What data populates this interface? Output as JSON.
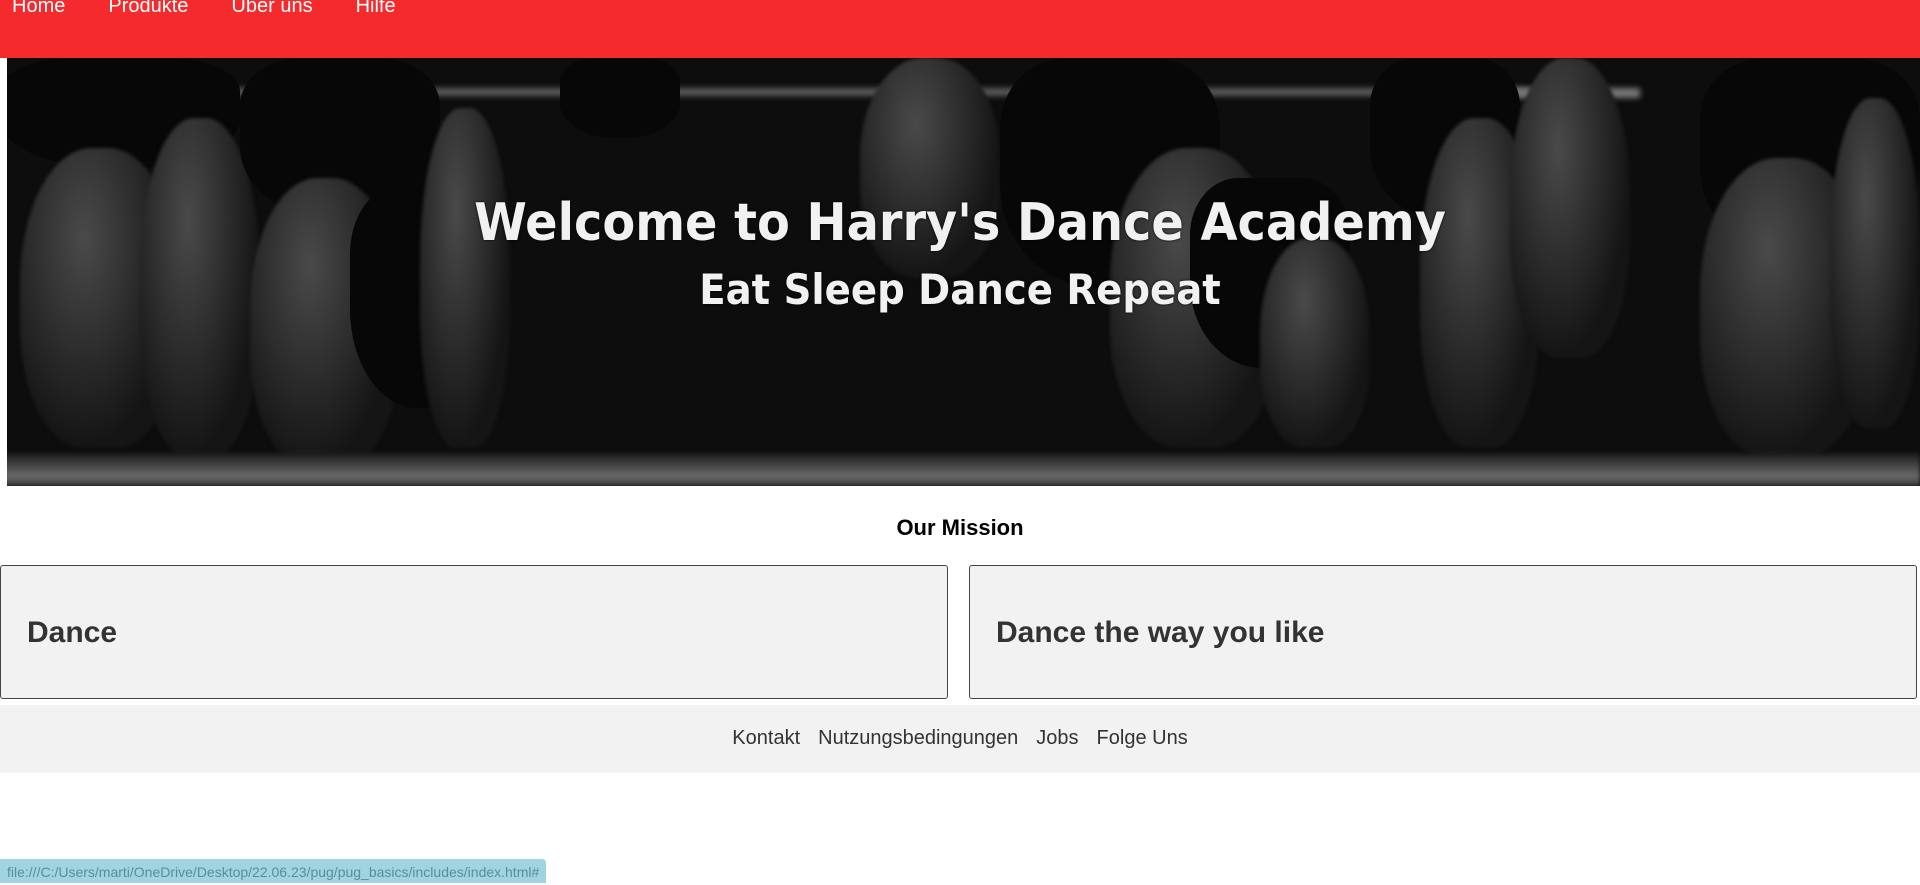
{
  "nav": {
    "items": [
      {
        "label": "Home"
      },
      {
        "label": "Produkte"
      },
      {
        "label": "Über uns"
      },
      {
        "label": "Hilfe"
      }
    ]
  },
  "hero": {
    "title": "Welcome to Harry's Dance Academy",
    "subtitle": "Eat Sleep Dance Repeat"
  },
  "mission": {
    "heading": "Our Mission",
    "cards": [
      {
        "title": "Dance"
      },
      {
        "title": "Dance the way you like"
      }
    ]
  },
  "footer": {
    "links": [
      {
        "label": "Kontakt"
      },
      {
        "label": "Nutzungsbedingungen"
      },
      {
        "label": "Jobs"
      },
      {
        "label": "Folge Uns"
      }
    ]
  },
  "status_bar": {
    "url": "file:///C:/Users/marti/OneDrive/Desktop/22.06.23/pug/pug_basics/includes/index.html#"
  },
  "colors": {
    "navbar": "#f42a2c",
    "card_background": "#f2f2f2",
    "status_bar": "#9fd5e1"
  }
}
